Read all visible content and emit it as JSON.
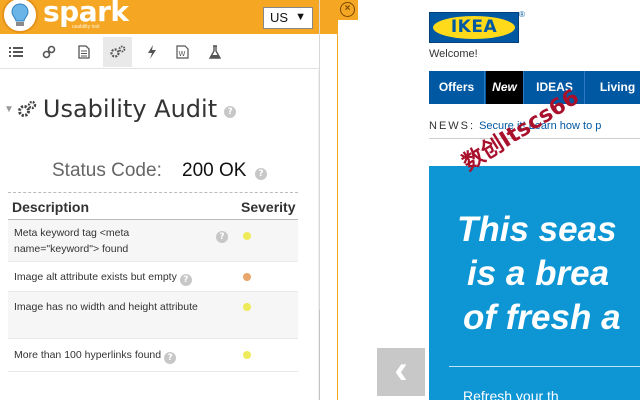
{
  "spark": {
    "app_name": "spark",
    "tagline": "usability tool",
    "locale": "US",
    "tabs": [
      {
        "id": "list",
        "icon": "list-icon"
      },
      {
        "id": "links",
        "icon": "link-icon"
      },
      {
        "id": "document",
        "icon": "document-icon"
      },
      {
        "id": "usability",
        "icon": "gears-icon",
        "active": true
      },
      {
        "id": "performance",
        "icon": "lightning-icon"
      },
      {
        "id": "w3c",
        "icon": "w3c-icon"
      },
      {
        "id": "lab",
        "icon": "flask-icon"
      }
    ],
    "section_title": "Usability Audit",
    "status_label": "Status Code:",
    "status_value": "200 OK",
    "table": {
      "col_description": "Description",
      "col_severity": "Severity",
      "rows": [
        {
          "description": "Meta keyword tag <meta name=\"keyword\"> found",
          "severity": "low",
          "color": "#eeea59"
        },
        {
          "description": "Image alt attribute exists but empty",
          "severity": "medium",
          "color": "#e9a66b"
        },
        {
          "description": "Image has no width and height attribute",
          "severity": "low",
          "color": "#eeea59"
        },
        {
          "description": "More than 100 hyperlinks found",
          "severity": "low",
          "color": "#eeea59"
        }
      ]
    }
  },
  "ikea": {
    "logo_text": "IKEA",
    "registered_mark": "®",
    "welcome": "Welcome!",
    "nav": [
      "Offers",
      "New",
      "IDEAS",
      "Living"
    ],
    "news_label": "NEWS:",
    "news_link": "Secure it! Learn how to p",
    "hero_lines": [
      "This seas",
      "is a brea",
      "of fresh a"
    ],
    "hero_sub": "Refresh your th",
    "colors": {
      "brand_blue": "#0058a3",
      "brand_yellow": "#ffda1a",
      "hero_blue": "#0e96d4"
    }
  },
  "watermark": "数创Itscs66",
  "colors": {
    "spark_orange": "#f5a623"
  }
}
